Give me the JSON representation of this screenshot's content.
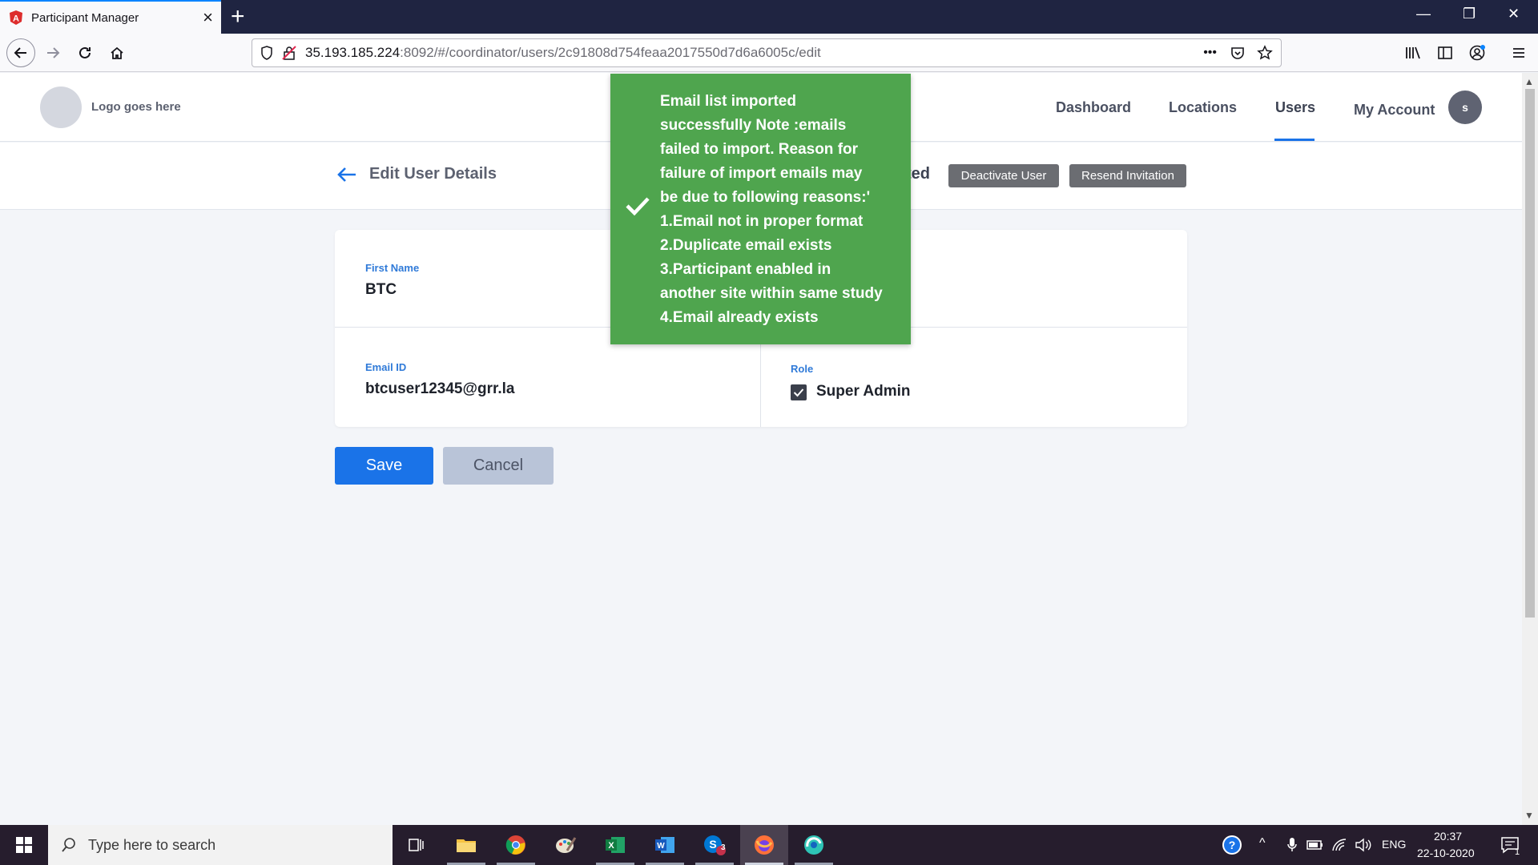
{
  "browser": {
    "tab_title": "Participant Manager",
    "url_host": "35.193.185.224",
    "url_rest": ":8092/#/coordinator/users/2c91808d754feaa2017550d7d6a6005c/edit",
    "url_more": "•••"
  },
  "header": {
    "logo_text": "Logo goes here",
    "nav": {
      "dashboard": "Dashboard",
      "locations": "Locations",
      "users": "Users",
      "my_account": "My Account"
    },
    "avatar_initial": "s"
  },
  "subheader": {
    "title": "Edit User Details",
    "status_fragment": "ted",
    "deactivate_label": "Deactivate User",
    "resend_label": "Resend Invitation"
  },
  "form": {
    "first_name_label": "First Name",
    "first_name_value": "BTC",
    "email_label": "Email ID",
    "email_value": "btcuser12345@grr.la",
    "role_label": "Role",
    "role_value": "Super Admin",
    "role_checked": true
  },
  "actions": {
    "save_label": "Save",
    "cancel_label": "Cancel"
  },
  "toast": {
    "lines": [
      "Email list imported",
      "successfully Note :emails",
      "failed to import. Reason for",
      "failure of import emails may",
      "be due to following reasons:'",
      "1.Email not in proper format",
      "2.Duplicate email exists",
      "3.Participant enabled in",
      "another site within same study",
      "4.Email already exists"
    ],
    "color": "#4fa54e"
  },
  "taskbar": {
    "search_placeholder": "Type here to search",
    "lang": "ENG",
    "time": "20:37",
    "date": "22-10-2020",
    "skype_badge": "3",
    "notification_count": "1"
  },
  "colors": {
    "primary": "#1a73e8",
    "label": "#2f7ad8"
  }
}
